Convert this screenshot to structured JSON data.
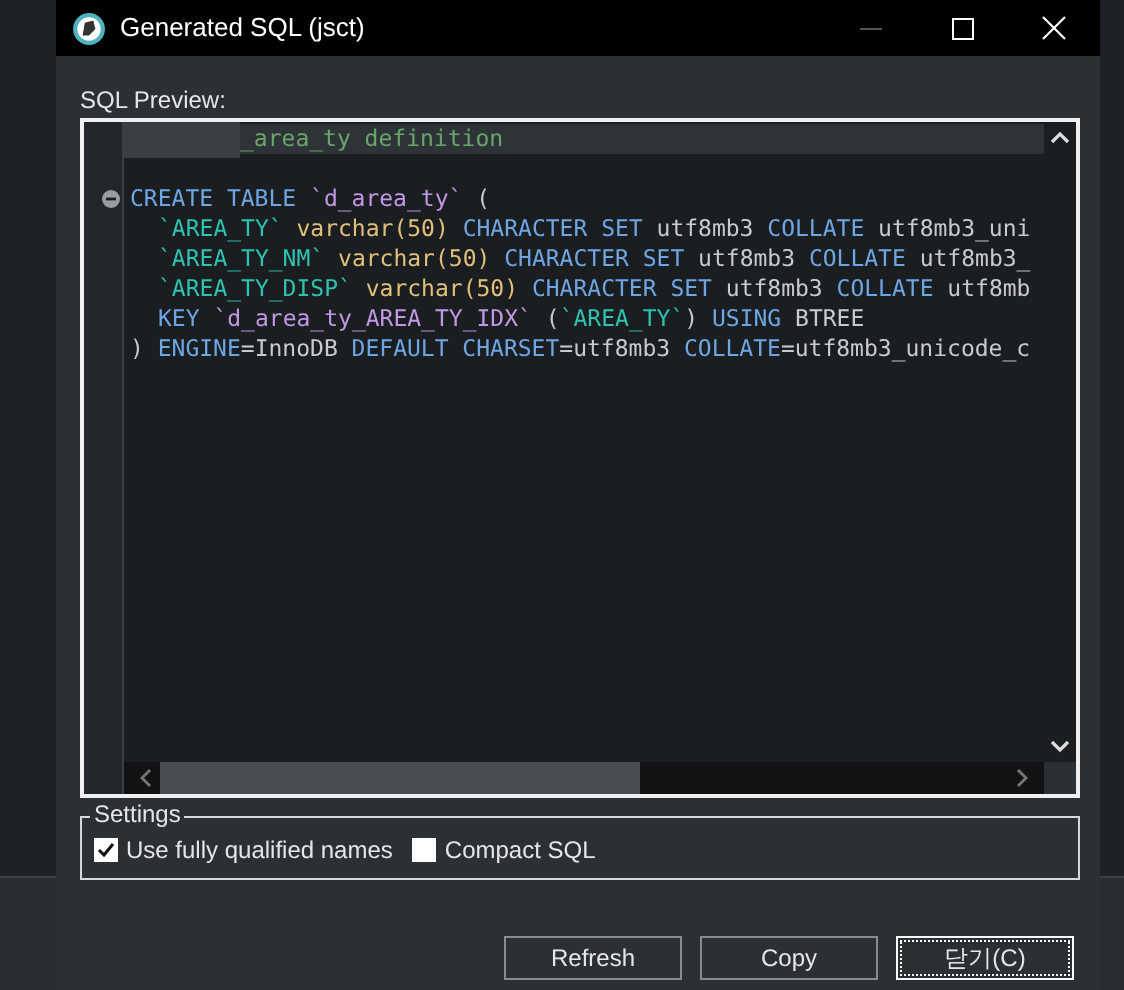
{
  "window": {
    "title": "Generated SQL (jsct)",
    "controls": [
      {
        "kind": "minimize",
        "disabled": true
      },
      {
        "kind": "maximize",
        "disabled": false
      },
      {
        "kind": "close",
        "disabled": false
      }
    ]
  },
  "preview": {
    "label": "SQL Preview:",
    "lines": [
      {
        "foldable": false,
        "current": true,
        "redacted": true,
        "tokens": [
          {
            "kind": "comment",
            "text": "_area_ty definition"
          }
        ]
      },
      {
        "foldable": false,
        "current": false,
        "redacted": false
      },
      {
        "foldable": true,
        "current": false,
        "redacted": false,
        "tokens": [
          {
            "kind": "keyword",
            "text": "CREATE TABLE "
          },
          {
            "kind": "identifier",
            "text": "`d_area_ty`"
          },
          {
            "kind": "plain",
            "text": " ("
          }
        ]
      },
      {
        "foldable": false,
        "current": false,
        "redacted": false,
        "indented": true,
        "tokens": [
          {
            "kind": "column",
            "text": "`AREA_TY`"
          },
          {
            "kind": "type",
            "text": " varchar(50)"
          },
          {
            "kind": "keyword",
            "text": " CHARACTER SET "
          },
          {
            "kind": "plain",
            "text": "utf8mb3 "
          },
          {
            "kind": "keyword",
            "text": "COLLATE "
          },
          {
            "kind": "plain",
            "text": "utf8mb3_uni"
          }
        ]
      },
      {
        "foldable": false,
        "current": false,
        "redacted": false,
        "indented": true,
        "tokens": [
          {
            "kind": "column",
            "text": "`AREA_TY_NM`"
          },
          {
            "kind": "type",
            "text": " varchar(50)"
          },
          {
            "kind": "keyword",
            "text": " CHARACTER SET "
          },
          {
            "kind": "plain",
            "text": "utf8mb3 "
          },
          {
            "kind": "keyword",
            "text": "COLLATE "
          },
          {
            "kind": "plain",
            "text": "utf8mb3_"
          }
        ]
      },
      {
        "foldable": false,
        "current": false,
        "redacted": false,
        "indented": true,
        "tokens": [
          {
            "kind": "column",
            "text": "`AREA_TY_DISP`"
          },
          {
            "kind": "type",
            "text": " varchar(50)"
          },
          {
            "kind": "keyword",
            "text": " CHARACTER SET "
          },
          {
            "kind": "plain",
            "text": "utf8mb3 "
          },
          {
            "kind": "keyword",
            "text": "COLLATE "
          },
          {
            "kind": "plain",
            "text": "utf8mb"
          }
        ]
      },
      {
        "foldable": false,
        "current": false,
        "redacted": false,
        "indented": true,
        "tokens": [
          {
            "kind": "keyword",
            "text": "KEY "
          },
          {
            "kind": "identifier",
            "text": "`d_area_ty_AREA_TY_IDX`"
          },
          {
            "kind": "plain",
            "text": " ("
          },
          {
            "kind": "column",
            "text": "`AREA_TY`"
          },
          {
            "kind": "plain",
            "text": ") "
          },
          {
            "kind": "keyword",
            "text": "USING "
          },
          {
            "kind": "plain",
            "text": "BTREE"
          }
        ]
      },
      {
        "foldable": false,
        "current": false,
        "redacted": false,
        "tokens": [
          {
            "kind": "plain",
            "text": ") "
          },
          {
            "kind": "keyword",
            "text": "ENGINE"
          },
          {
            "kind": "plain",
            "text": "=InnoDB "
          },
          {
            "kind": "keyword",
            "text": "DEFAULT CHARSET"
          },
          {
            "kind": "plain",
            "text": "=utf8mb3 "
          },
          {
            "kind": "keyword",
            "text": "COLLATE"
          },
          {
            "kind": "plain",
            "text": "=utf8mb3_unicode_c"
          }
        ]
      }
    ]
  },
  "settings": {
    "title": "Settings",
    "options": [
      {
        "label": "Use fully qualified names",
        "checked": true
      },
      {
        "label": "Compact SQL",
        "checked": false
      }
    ]
  },
  "buttons": [
    {
      "label": "Refresh",
      "focused": false
    },
    {
      "label": "Copy",
      "focused": false
    },
    {
      "label": "닫기(C)",
      "focused": true
    }
  ]
}
